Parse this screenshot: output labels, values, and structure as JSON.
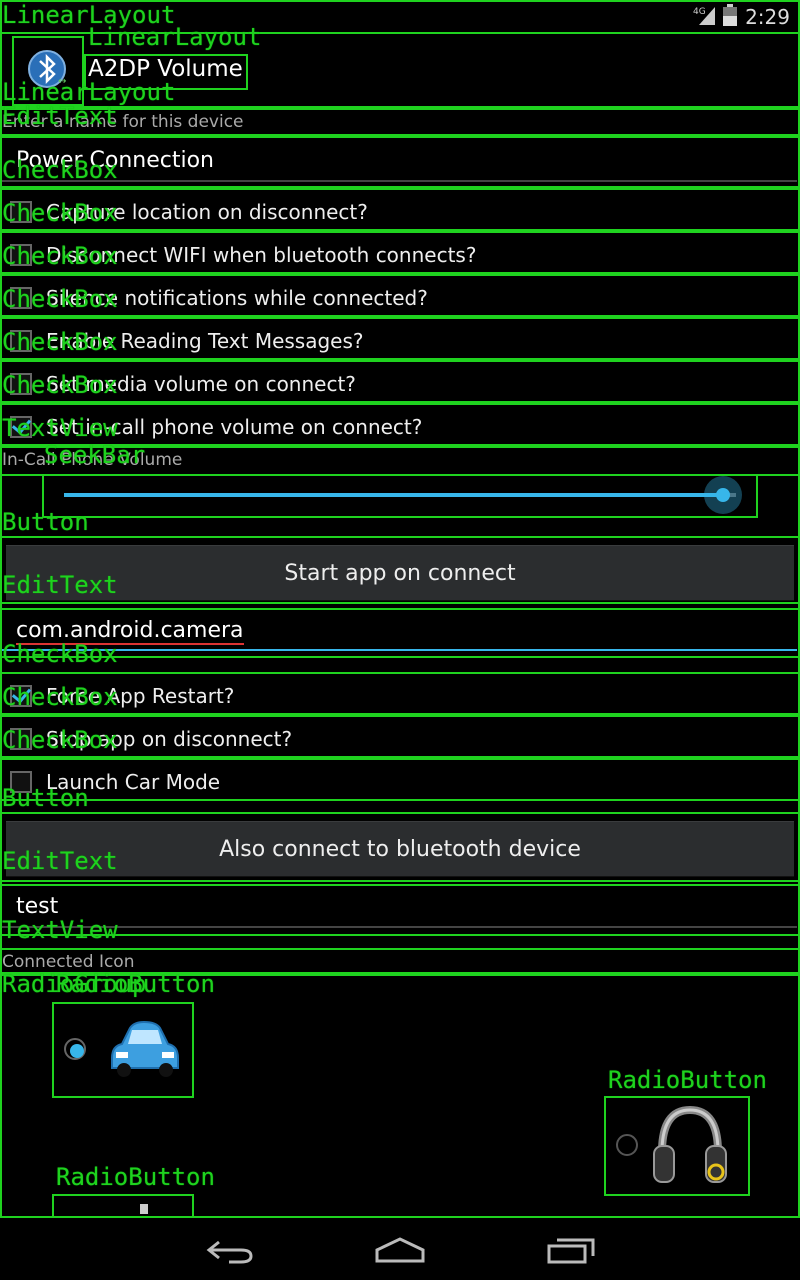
{
  "status": {
    "network": "4G",
    "time": "2:29"
  },
  "header": {
    "device_name": "A2DP Volume"
  },
  "name_section": {
    "label": "Enter a name for this device",
    "value": "Power Connection"
  },
  "checkboxes": [
    {
      "label": "Capture location on disconnect?",
      "checked": false
    },
    {
      "label": "Disconnect WIFI when bluetooth connects?",
      "checked": false
    },
    {
      "label": "Silence notifications while connected?",
      "checked": false
    },
    {
      "label": "Enable Reading Text Messages?",
      "checked": false
    },
    {
      "label": "Set media volume on connect?",
      "checked": false
    },
    {
      "label": "Set in-call phone volume on connect?",
      "checked": true
    }
  ],
  "volume": {
    "label": "In-Call Phone Volume",
    "level": 0.98
  },
  "start_app": {
    "button_label": "Start app on connect",
    "package_value": "com.android.camera"
  },
  "app_options": [
    {
      "label": "Force App Restart?",
      "checked": true
    },
    {
      "label": "Stop app on disconnect?",
      "checked": false
    },
    {
      "label": "Launch Car Mode",
      "checked": false
    }
  ],
  "bt_connect": {
    "button_label": "Also connect to bluetooth device",
    "value": "test"
  },
  "icon_section": {
    "label": "Connected Icon"
  },
  "overlay_labels": {
    "textview": "TextView",
    "edittext": "EditText",
    "checkbox": "CheckBox",
    "seekbar": "SeekBar",
    "button": "Button",
    "radiogroup": "RadioGroup",
    "radiobutton": "RadioButton",
    "linearlayout": "LinearLayout"
  },
  "colors": {
    "accent": "#37b6ea",
    "overlay": "#1fd21f"
  }
}
